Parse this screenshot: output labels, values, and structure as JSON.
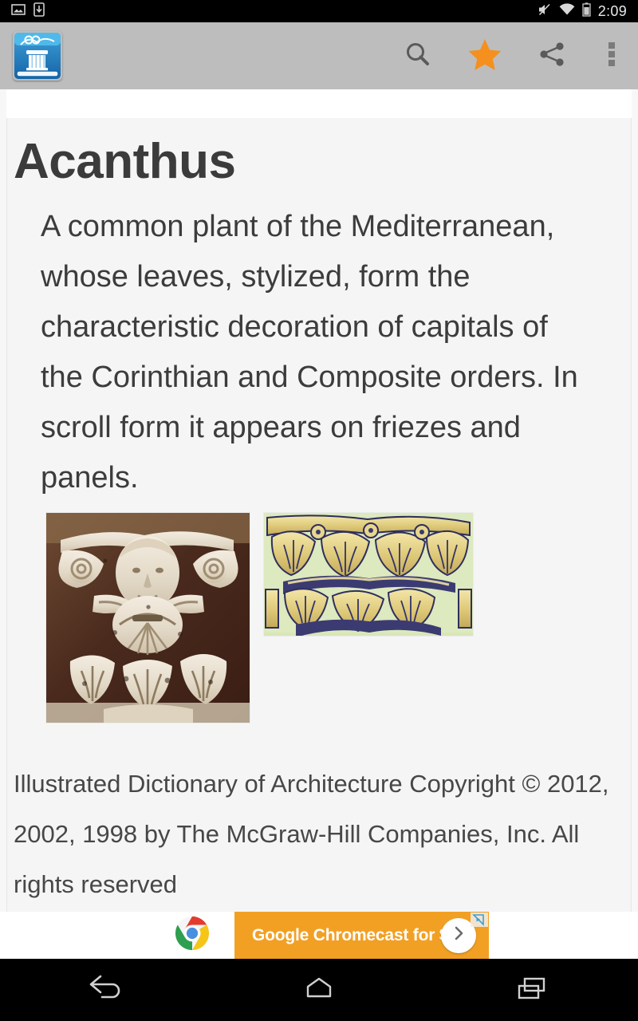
{
  "status_bar": {
    "left_icons": [
      {
        "name": "screenshot-icon",
        "label": "Screenshot captured"
      },
      {
        "name": "download-icon",
        "label": "Download complete"
      }
    ],
    "right_icons": [
      {
        "name": "mute-icon",
        "label": "Ringer muted"
      },
      {
        "name": "wifi-icon",
        "label": "Wi-Fi connected"
      },
      {
        "name": "battery-icon",
        "label": "Battery"
      }
    ],
    "time": "2:09"
  },
  "action_bar": {
    "app_icon_name": "architecture-dictionary-app-icon",
    "actions": [
      {
        "name": "search-button",
        "icon": "search-icon",
        "label": "Search"
      },
      {
        "name": "favorite-button",
        "icon": "star-icon",
        "label": "Favorite",
        "active": true,
        "color": "#f5901e"
      },
      {
        "name": "share-button",
        "icon": "share-icon",
        "label": "Share"
      },
      {
        "name": "overflow-menu-button",
        "icon": "more-vertical-icon",
        "label": "More options"
      }
    ],
    "background_color": "#bdbdbd"
  },
  "entry": {
    "title": "Acanthus",
    "definition": "A common plant of the Mediterranean, whose leaves, stylized, form the characteristic decoration of capitals of the Corinthian and Composite orders. In scroll form it appears on friezes and panels.",
    "figures": [
      {
        "name": "figure-corinthian-capital-photo",
        "alt": "Carved stone Corinthian capital with human face and acanthus leaves"
      },
      {
        "name": "figure-acanthus-capital-illustration",
        "alt": "Illustration of an acanthus-leaf capital in yellow and navy"
      }
    ],
    "copyright": "Illustrated Dictionary of Architecture Copyright © 2012, 2002, 1998 by The McGraw-Hill Companies, Inc. All rights reserved"
  },
  "advertisement": {
    "text": "Google Chromecast for $35",
    "brand_icon": "chrome-logo-icon",
    "cta_icon": "chevron-right-icon",
    "adchoices_icon": "adchoices-icon",
    "background_color": "#f2a024"
  },
  "nav_bar": {
    "buttons": [
      {
        "name": "nav-back-button",
        "icon": "back-arrow-icon",
        "label": "Back"
      },
      {
        "name": "nav-home-button",
        "icon": "home-icon",
        "label": "Home"
      },
      {
        "name": "nav-recents-button",
        "icon": "recents-icon",
        "label": "Recent apps"
      }
    ]
  }
}
